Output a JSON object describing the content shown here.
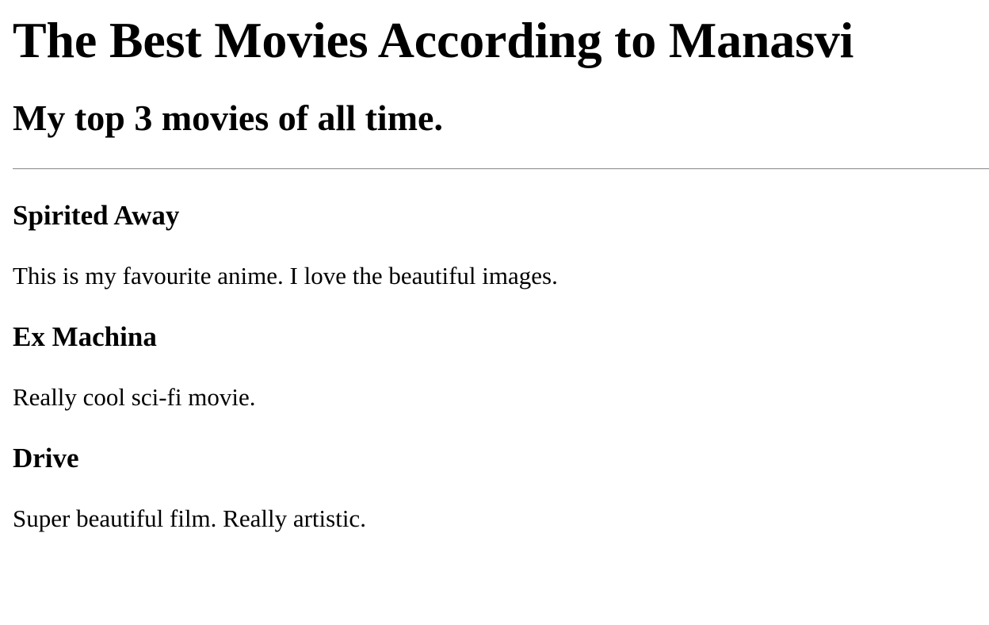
{
  "page": {
    "title": "The Best Movies According to Manasvi",
    "subtitle": "My top 3 movies of all time."
  },
  "movies": [
    {
      "title": "Spirited Away",
      "description": "This is my favourite anime. I love the beautiful images."
    },
    {
      "title": "Ex Machina",
      "description": "Really cool sci-fi movie."
    },
    {
      "title": "Drive",
      "description": "Super beautiful film. Really artistic."
    }
  ]
}
